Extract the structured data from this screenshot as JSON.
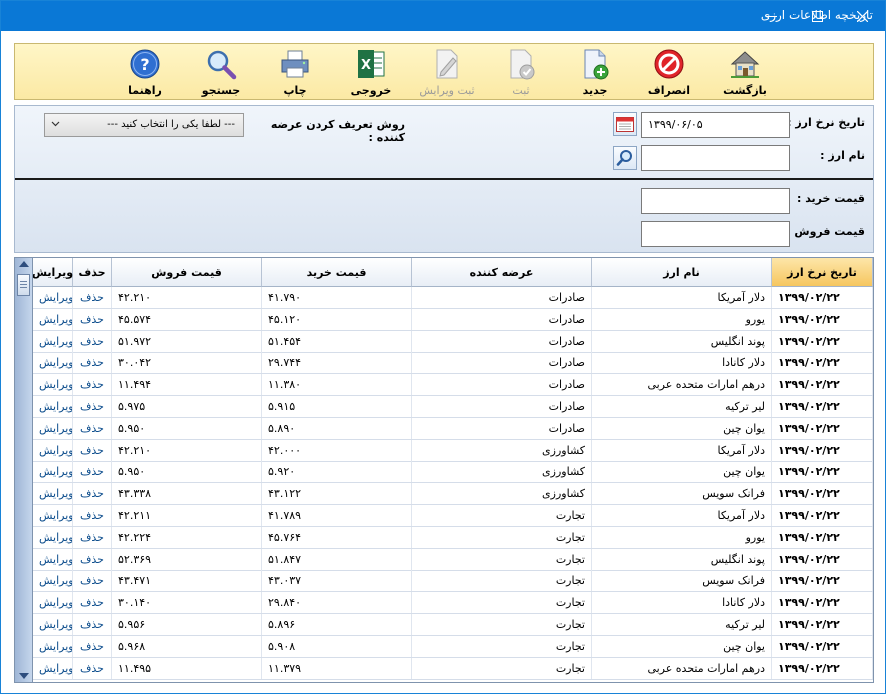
{
  "window": {
    "title": "تاریخچه اطلاعات ارزی"
  },
  "toolbar": {
    "back": "بازگشت",
    "cancel": "انصراف",
    "new": "جدید",
    "save": "ثبت",
    "save_edit": "ثبت ویرایش",
    "export": "خروجی",
    "print": "چاپ",
    "search": "جستجو",
    "help": "راهنما"
  },
  "filter": {
    "date_label": "تاریخ نرخ ارز :",
    "date_value": "۱۳۹۹/۰۶/۰۵",
    "currency_label": "نام ارز :",
    "currency_value": "",
    "supplier_label": "روش تعریف کردن عرضه کننده :",
    "supplier_placeholder": "--- لطفا یکی را انتخاب کنید ---",
    "buy_label": "قیمت خرید :",
    "buy_value": "",
    "sell_label": "قیمت فروش :",
    "sell_value": ""
  },
  "grid": {
    "columns": {
      "date": "تاریخ نرخ ارز",
      "name": "نام ارز",
      "supplier": "عرضه کننده",
      "buy": "قیمت خرید",
      "sell": "قیمت فروش",
      "delete": "حذف",
      "edit": "ویرایش"
    },
    "rows": [
      {
        "date": "۱۳۹۹/۰۲/۲۲",
        "name": "دلار آمریکا",
        "supplier": "صادرات",
        "buy": "۴۱.۷۹۰",
        "sell": "۴۲.۲۱۰",
        "delete": "حذف",
        "edit": "ویرایش"
      },
      {
        "date": "۱۳۹۹/۰۲/۲۲",
        "name": "یورو",
        "supplier": "صادرات",
        "buy": "۴۵.۱۲۰",
        "sell": "۴۵.۵۷۴",
        "delete": "حذف",
        "edit": "ویرایش"
      },
      {
        "date": "۱۳۹۹/۰۲/۲۲",
        "name": "پوند انگلیس",
        "supplier": "صادرات",
        "buy": "۵۱.۴۵۴",
        "sell": "۵۱.۹۷۲",
        "delete": "حذف",
        "edit": "ویرایش"
      },
      {
        "date": "۱۳۹۹/۰۲/۲۲",
        "name": "دلار کانادا",
        "supplier": "صادرات",
        "buy": "۲۹.۷۴۴",
        "sell": "۳۰.۰۴۲",
        "delete": "حذف",
        "edit": "ویرایش"
      },
      {
        "date": "۱۳۹۹/۰۲/۲۲",
        "name": "درهم امارات متحده عربی",
        "supplier": "صادرات",
        "buy": "۱۱.۳۸۰",
        "sell": "۱۱.۴۹۴",
        "delete": "حذف",
        "edit": "ویرایش"
      },
      {
        "date": "۱۳۹۹/۰۲/۲۲",
        "name": "لیر ترکیه",
        "supplier": "صادرات",
        "buy": "۵.۹۱۵",
        "sell": "۵.۹۷۵",
        "delete": "حذف",
        "edit": "ویرایش"
      },
      {
        "date": "۱۳۹۹/۰۲/۲۲",
        "name": "یوان چین",
        "supplier": "صادرات",
        "buy": "۵.۸۹۰",
        "sell": "۵.۹۵۰",
        "delete": "حذف",
        "edit": "ویرایش"
      },
      {
        "date": "۱۳۹۹/۰۲/۲۲",
        "name": "دلار آمریکا",
        "supplier": "کشاورزی",
        "buy": "۴۲.۰۰۰",
        "sell": "۴۲.۲۱۰",
        "delete": "حذف",
        "edit": "ویرایش"
      },
      {
        "date": "۱۳۹۹/۰۲/۲۲",
        "name": "یوان چین",
        "supplier": "کشاورزی",
        "buy": "۵.۹۲۰",
        "sell": "۵.۹۵۰",
        "delete": "حذف",
        "edit": "ویرایش"
      },
      {
        "date": "۱۳۹۹/۰۲/۲۲",
        "name": "فرانک سویس",
        "supplier": "کشاورزی",
        "buy": "۴۳.۱۲۲",
        "sell": "۴۳.۳۳۸",
        "delete": "حذف",
        "edit": "ویرایش"
      },
      {
        "date": "۱۳۹۹/۰۲/۲۲",
        "name": "دلار آمریکا",
        "supplier": "تجارت",
        "buy": "۴۱.۷۸۹",
        "sell": "۴۲.۲۱۱",
        "delete": "حذف",
        "edit": "ویرایش"
      },
      {
        "date": "۱۳۹۹/۰۲/۲۲",
        "name": "یورو",
        "supplier": "تجارت",
        "buy": "۴۵.۷۶۴",
        "sell": "۴۲.۲۲۴",
        "delete": "حذف",
        "edit": "ویرایش"
      },
      {
        "date": "۱۳۹۹/۰۲/۲۲",
        "name": "پوند انگلیس",
        "supplier": "تجارت",
        "buy": "۵۱.۸۴۷",
        "sell": "۵۲.۳۶۹",
        "delete": "حذف",
        "edit": "ویرایش"
      },
      {
        "date": "۱۳۹۹/۰۲/۲۲",
        "name": "فرانک سویس",
        "supplier": "تجارت",
        "buy": "۴۳.۰۳۷",
        "sell": "۴۳.۴۷۱",
        "delete": "حذف",
        "edit": "ویرایش"
      },
      {
        "date": "۱۳۹۹/۰۲/۲۲",
        "name": "دلار کانادا",
        "supplier": "تجارت",
        "buy": "۲۹.۸۴۰",
        "sell": "۳۰.۱۴۰",
        "delete": "حذف",
        "edit": "ویرایش"
      },
      {
        "date": "۱۳۹۹/۰۲/۲۲",
        "name": "لیر ترکیه",
        "supplier": "تجارت",
        "buy": "۵.۸۹۶",
        "sell": "۵.۹۵۶",
        "delete": "حذف",
        "edit": "ویرایش"
      },
      {
        "date": "۱۳۹۹/۰۲/۲۲",
        "name": "یوان چین",
        "supplier": "تجارت",
        "buy": "۵.۹۰۸",
        "sell": "۵.۹۶۸",
        "delete": "حذف",
        "edit": "ویرایش"
      },
      {
        "date": "۱۳۹۹/۰۲/۲۲",
        "name": "درهم امارات متحده عربی",
        "supplier": "تجارت",
        "buy": "۱۱.۳۷۹",
        "sell": "۱۱.۴۹۵",
        "delete": "حذف",
        "edit": "ویرایش"
      }
    ]
  },
  "colors": {
    "titlebar": "#0a78d6",
    "toolbar": "#fbe9a4",
    "sorted_header": "#f6c65f",
    "filter_panel": "#d9e3f0"
  },
  "icons": {
    "back": "home-icon",
    "cancel": "no-entry-icon",
    "new": "new-document-icon",
    "save": "save-check-icon",
    "save_edit": "edit-pencil-icon",
    "export": "excel-icon",
    "print": "printer-icon",
    "search": "magnifier-icon",
    "help": "help-icon"
  }
}
